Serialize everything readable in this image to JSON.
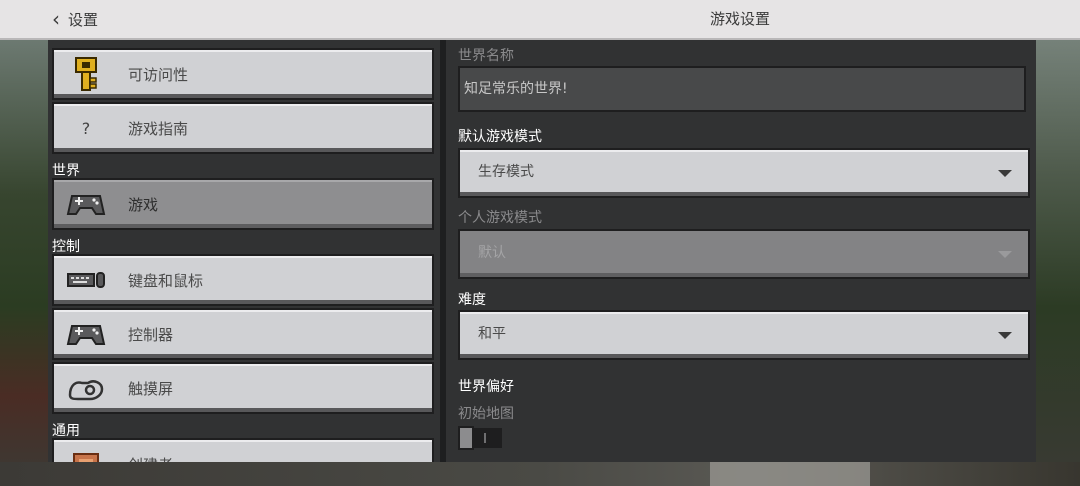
{
  "header": {
    "back_label": "设置",
    "title": "游戏设置"
  },
  "sidebar": {
    "items": [
      {
        "label": "可访问性",
        "icon": "key-icon"
      },
      {
        "label": "游戏指南",
        "icon": "question-icon",
        "icon_glyph": "?"
      },
      {
        "section": "世界"
      },
      {
        "label": "游戏",
        "icon": "gamepad-icon",
        "active": true
      },
      {
        "section": "控制"
      },
      {
        "label": "键盘和鼠标",
        "icon": "keyboard-icon"
      },
      {
        "label": "控制器",
        "icon": "controller-icon"
      },
      {
        "label": "触摸屏",
        "icon": "touch-icon"
      },
      {
        "section": "通用"
      },
      {
        "label": "创建者",
        "icon": "creator-icon"
      }
    ]
  },
  "main": {
    "world_name_label": "世界名称",
    "world_name_value": "知足常乐的世界!",
    "default_mode_label": "默认游戏模式",
    "default_mode_value": "生存模式",
    "personal_mode_label": "个人游戏模式",
    "personal_mode_value": "默认",
    "difficulty_label": "难度",
    "difficulty_value": "和平",
    "world_prefs_label": "世界偏好",
    "starting_map_label": "初始地图",
    "starting_map_on": false
  },
  "colors": {
    "topbar": "#e6e4e5",
    "panel": "#313233",
    "button": "#d0d1d4",
    "button_active": "#8e8e90",
    "key_gold": "#e0b020"
  }
}
